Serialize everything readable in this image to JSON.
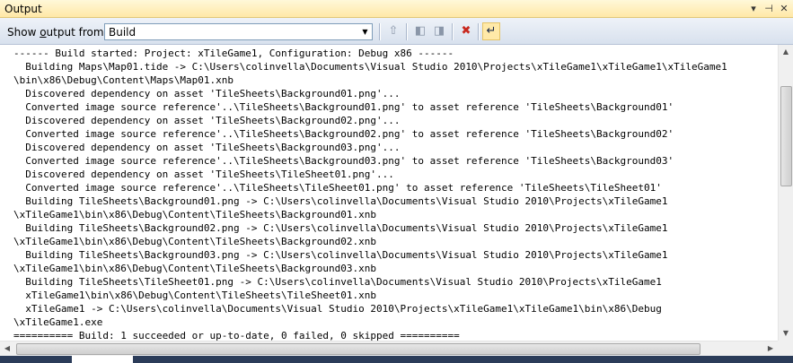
{
  "window": {
    "title": "Output",
    "dropdown_icon": "dropdown-arrow-icon",
    "pin_icon": "pin-icon",
    "close_icon": "close-icon"
  },
  "toolbar": {
    "show_output_label": "Show output from:",
    "source_value": "Build",
    "buttons": [
      {
        "name": "go-to-previous-message-icon"
      },
      {
        "name": "find-message-in-code-icon"
      },
      {
        "name": "go-to-next-message-icon"
      },
      {
        "name": "clear-all-icon"
      },
      {
        "name": "toggle-word-wrap-icon",
        "active": true
      }
    ]
  },
  "output": {
    "text": "------ Build started: Project: xTileGame1, Configuration: Debug x86 ------\n  Building Maps\\Map01.tide -> C:\\Users\\colinvella\\Documents\\Visual Studio 2010\\Projects\\xTileGame1\\xTileGame1\\xTileGame1\n\\bin\\x86\\Debug\\Content\\Maps\\Map01.xnb\n  Discovered dependency on asset 'TileSheets\\Background01.png'...\n  Converted image source reference'..\\TileSheets\\Background01.png' to asset reference 'TileSheets\\Background01'\n  Discovered dependency on asset 'TileSheets\\Background02.png'...\n  Converted image source reference'..\\TileSheets\\Background02.png' to asset reference 'TileSheets\\Background02'\n  Discovered dependency on asset 'TileSheets\\Background03.png'...\n  Converted image source reference'..\\TileSheets\\Background03.png' to asset reference 'TileSheets\\Background03'\n  Discovered dependency on asset 'TileSheets\\TileSheet01.png'...\n  Converted image source reference'..\\TileSheets\\TileSheet01.png' to asset reference 'TileSheets\\TileSheet01'\n  Building TileSheets\\Background01.png -> C:\\Users\\colinvella\\Documents\\Visual Studio 2010\\Projects\\xTileGame1\n\\xTileGame1\\bin\\x86\\Debug\\Content\\TileSheets\\Background01.xnb\n  Building TileSheets\\Background02.png -> C:\\Users\\colinvella\\Documents\\Visual Studio 2010\\Projects\\xTileGame1\n\\xTileGame1\\bin\\x86\\Debug\\Content\\TileSheets\\Background02.xnb\n  Building TileSheets\\Background03.png -> C:\\Users\\colinvella\\Documents\\Visual Studio 2010\\Projects\\xTileGame1\n\\xTileGame1\\bin\\x86\\Debug\\Content\\TileSheets\\Background03.xnb\n  Building TileSheets\\TileSheet01.png -> C:\\Users\\colinvella\\Documents\\Visual Studio 2010\\Projects\\xTileGame1\n  xTileGame1\\bin\\x86\\Debug\\Content\\TileSheets\\TileSheet01.xnb\n  xTileGame1 -> C:\\Users\\colinvella\\Documents\\Visual Studio 2010\\Projects\\xTileGame1\\xTileGame1\\bin\\x86\\Debug\n\\xTileGame1.exe\n========== Build: 1 succeeded or up-to-date, 0 failed, 0 skipped ==========\n'"
  },
  "colors": {
    "title_bar": "#ffe8a6",
    "toolbar": "#d8e1ee",
    "frame": "#2b3c59",
    "active_tool": "#ffe9a8",
    "clear_icon": "#c8281e"
  }
}
